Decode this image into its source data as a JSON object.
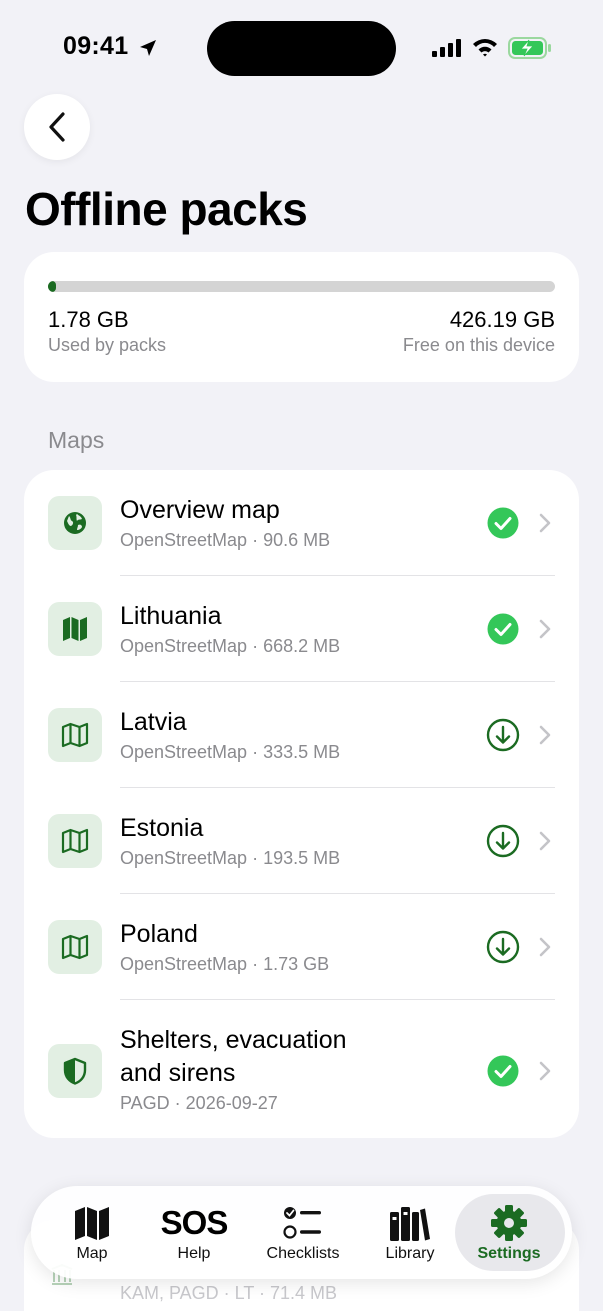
{
  "status_bar": {
    "time": "09:41"
  },
  "page": {
    "title": "Offline packs"
  },
  "colors": {
    "accent": "#1B6B22",
    "success": "#34C759",
    "background": "#F2F2F7"
  },
  "storage": {
    "used_value": "1.78 GB",
    "used_label": "Used by packs",
    "free_value": "426.19 GB",
    "free_label": "Free on this device",
    "used_fraction": 0.004
  },
  "maps": {
    "section_title": "Maps",
    "items": [
      {
        "title": "Overview map",
        "subtitle": "OpenStreetMap · 90.6 MB",
        "icon": "globe-icon",
        "status": "downloaded"
      },
      {
        "title": "Lithuania",
        "subtitle": "OpenStreetMap · 668.2 MB",
        "icon": "map-filled-icon",
        "status": "downloaded"
      },
      {
        "title": "Latvia",
        "subtitle": "OpenStreetMap · 333.5 MB",
        "icon": "map-outline-icon",
        "status": "download"
      },
      {
        "title": "Estonia",
        "subtitle": "OpenStreetMap · 193.5 MB",
        "icon": "map-outline-icon",
        "status": "download"
      },
      {
        "title": "Poland",
        "subtitle": "OpenStreetMap · 1.73 GB",
        "icon": "map-outline-icon",
        "status": "download"
      },
      {
        "title_line1": "Shelters, evacuation",
        "title_line2": "and sirens",
        "subtitle": "PAGD · 2026-09-27",
        "icon": "shield-icon",
        "status": "downloaded"
      }
    ]
  },
  "library_peek": {
    "subtitle": "KAM, PAGD · LT · 71.4 MB"
  },
  "tab_bar": {
    "tabs": [
      {
        "label": "Map",
        "icon": "map-icon"
      },
      {
        "label": "Help",
        "icon": "sos-icon",
        "glyph": "SOS"
      },
      {
        "label": "Checklists",
        "icon": "checklist-icon"
      },
      {
        "label": "Library",
        "icon": "books-icon"
      },
      {
        "label": "Settings",
        "icon": "gear-icon",
        "active": true
      }
    ]
  }
}
